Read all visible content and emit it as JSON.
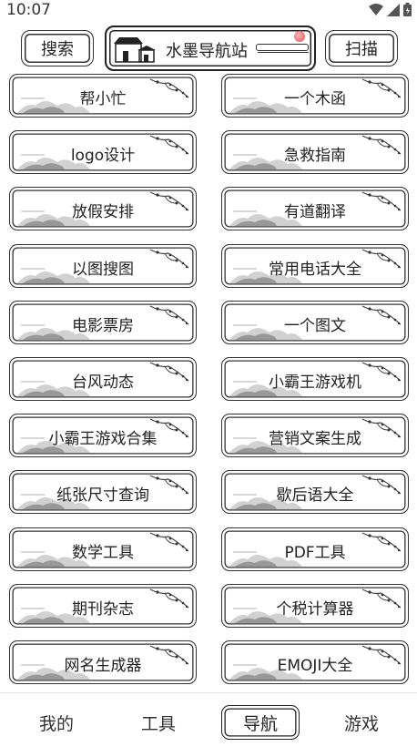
{
  "status": {
    "time": "10:07"
  },
  "header": {
    "search_label": "搜索",
    "title": "水墨导航站",
    "scan_label": "扫描"
  },
  "items": [
    "帮小忙",
    "一个木函",
    "logo设计",
    "急救指南",
    "放假安排",
    "有道翻译",
    "以图搜图",
    "常用电话大全",
    "电影票房",
    "一个图文",
    "台风动态",
    "小霸王游戏机",
    "小霸王游戏合集",
    "营销文案生成",
    "纸张尺寸查询",
    "歇后语大全",
    "数学工具",
    "PDF工具",
    "期刊杂志",
    "个税计算器",
    "网名生成器",
    "EMOJI大全"
  ],
  "tabs": [
    {
      "label": "我的"
    },
    {
      "label": "工具"
    },
    {
      "label": "导航",
      "active": true
    },
    {
      "label": "游戏"
    }
  ]
}
